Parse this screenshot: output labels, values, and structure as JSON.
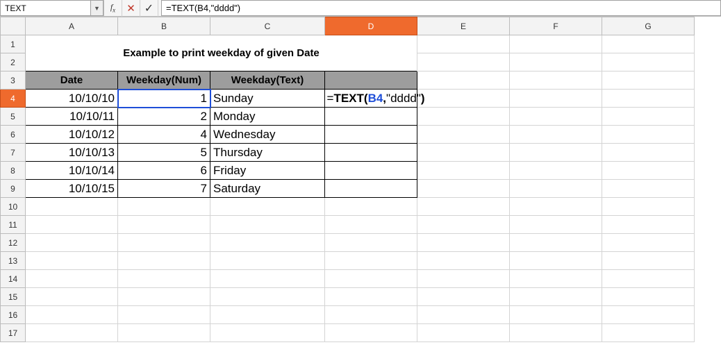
{
  "namebox": "TEXT",
  "formula_plain": "=TEXT(B4,\"dddd\")",
  "columns": [
    "A",
    "B",
    "C",
    "D",
    "E",
    "F",
    "G"
  ],
  "active_col": "D",
  "row_count": 17,
  "active_row": 4,
  "title": "Example to print weekday of given Date",
  "headers": {
    "A": "Date",
    "B": "Weekday(Num)",
    "C": "Weekday(Text)"
  },
  "rows": [
    {
      "date": "10/10/10",
      "num": "1",
      "text": "Sunday"
    },
    {
      "date": "10/10/11",
      "num": "2",
      "text": "Monday"
    },
    {
      "date": "10/10/12",
      "num": "4",
      "text": "Wednesday"
    },
    {
      "date": "10/10/13",
      "num": "5",
      "text": "Thursday"
    },
    {
      "date": "10/10/14",
      "num": "6",
      "text": "Friday"
    },
    {
      "date": "10/10/15",
      "num": "7",
      "text": "Saturday"
    }
  ],
  "editing_cell": {
    "prefix": "=",
    "fn": "TEXT",
    "open": "(",
    "ref": "B4",
    "comma": ",",
    "str": "\"dddd\"",
    "close": ")"
  }
}
